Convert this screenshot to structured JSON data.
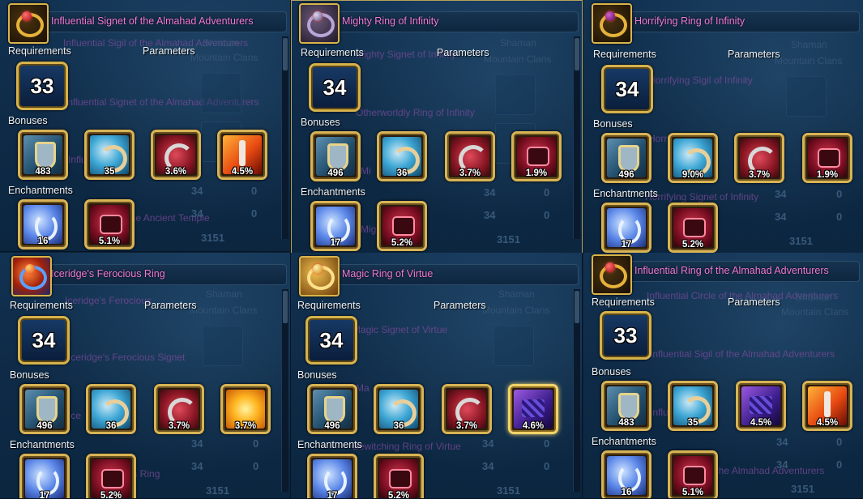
{
  "labels": {
    "requirements": "Requirements",
    "parameters": "Parameters",
    "bonuses": "Bonuses",
    "enchantments": "Enchantments"
  },
  "ghost": {
    "shaman": "Shaman",
    "clan": "Mountain Clans",
    "stat_a": "34",
    "stat_b": "0",
    "score": "3151"
  },
  "panels": [
    {
      "title": "Influential Signet of the Almahad Adventurers",
      "level": "33",
      "bonuses": [
        "483",
        "35",
        "3.6%",
        "4.5%"
      ],
      "enchantments": [
        "16",
        "5.1%"
      ],
      "ghost_lines": [
        "Influential Sigil of the Almahad Adventurers",
        "Influential Signet of the Almahad Adventurers",
        "Influ",
        "of the Ancient Temple"
      ]
    },
    {
      "title": "Mighty Ring of Infinity",
      "level": "34",
      "bonuses": [
        "496",
        "36",
        "3.7%",
        "1.9%"
      ],
      "enchantments": [
        "17",
        "5.2%"
      ],
      "ghost_lines": [
        "Mighty Signet of Infinity",
        "Otherworldly Ring of Infinity",
        "Mi",
        "Mighty"
      ]
    },
    {
      "title": "Horrifying Ring of Infinity",
      "level": "34",
      "bonuses": [
        "496",
        "9.0%",
        "3.7%",
        "1.9%"
      ],
      "enchantments": [
        "17",
        "5.2%"
      ],
      "ghost_lines": [
        "Horrifying Sigil of Infinity",
        "Horri",
        "Horrifying Signet of Infinity",
        ""
      ]
    },
    {
      "title": "Iceridge's Ferocious Ring",
      "level": "34",
      "bonuses": [
        "496",
        "36",
        "3.7%",
        "3.7%"
      ],
      "enchantments": [
        "17",
        "5.2%"
      ],
      "ghost_lines": [
        "Iceridge's Ferocious",
        "Iceridge's Ferocious Signet",
        "Ice",
        "ous Ring"
      ]
    },
    {
      "title": "Magic Ring of Virtue",
      "level": "34",
      "bonuses": [
        "496",
        "36",
        "3.7%",
        "4.6%"
      ],
      "enchantments": [
        "17",
        "5.2%"
      ],
      "ghost_lines": [
        "Magic Signet of Virtue",
        "Ma",
        "Bewitching Ring of Virtue",
        ""
      ]
    },
    {
      "title": "Influential Ring of the Almahad Adventurers",
      "level": "33",
      "bonuses": [
        "483",
        "35",
        "4.5%",
        "4.5%"
      ],
      "enchantments": [
        "16",
        "5.1%"
      ],
      "ghost_lines": [
        "Influential Circle of the Almahad Adventurers",
        "Influential Sigil of the Almahad Adventurers",
        "Influ",
        "of the Almahad Adventurers"
      ]
    }
  ],
  "art": {
    "bonus_types": [
      [
        "def",
        "atk",
        "crit",
        "fire"
      ],
      [
        "def",
        "atk",
        "crit",
        "fist"
      ],
      [
        "def",
        "atk",
        "crit",
        "fist"
      ],
      [
        "def",
        "atk",
        "crit",
        "sun"
      ],
      [
        "def",
        "atk",
        "crit",
        "gem"
      ],
      [
        "def",
        "atk",
        "gem",
        "fire"
      ]
    ],
    "enchant_types": [
      "water",
      "fist"
    ],
    "highlighted_slot_panel5": "4.6%"
  },
  "colors": {
    "title": "#f07ad8",
    "frame": "#d8b455",
    "background": "#0b2238"
  }
}
